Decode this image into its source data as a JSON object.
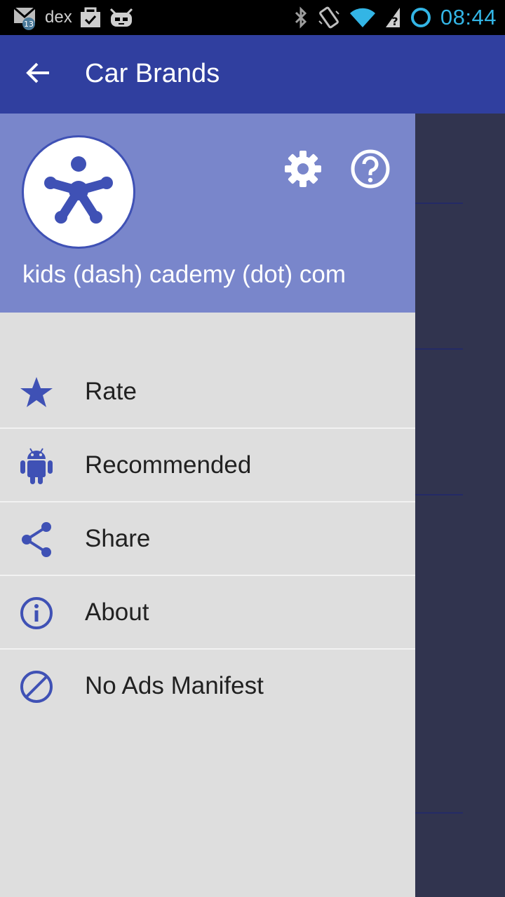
{
  "status_bar": {
    "carrier_text": "dex",
    "mail_badge": "13",
    "time": "08:44",
    "icons": [
      "mail-icon",
      "clipboard-check-icon",
      "android-robot-icon",
      "bluetooth-icon",
      "vibrate-icon",
      "wifi-icon",
      "signal-question-icon",
      "sync-ring-icon"
    ]
  },
  "app_bar": {
    "title": "Car Brands",
    "back_icon": "arrow-left-icon"
  },
  "drawer": {
    "header": {
      "site_text": "kids (dash) cademy (dot) com",
      "avatar_icon": "kids-academy-figure-icon",
      "settings_icon": "gear-icon",
      "help_icon": "help-circle-icon"
    },
    "menu": [
      {
        "label": "Rate",
        "icon": "star-icon"
      },
      {
        "label": "Recommended",
        "icon": "android-icon"
      },
      {
        "label": "Share",
        "icon": "share-icon"
      },
      {
        "label": "About",
        "icon": "info-icon"
      },
      {
        "label": "No Ads Manifest",
        "icon": "block-icon"
      }
    ]
  },
  "colors": {
    "primary": "#303f9f",
    "accent_icon": "#3f51b5",
    "header_bg": "#7986cb",
    "drawer_bg": "#dedede",
    "scrim": "#31344f",
    "clock": "#33b5e5"
  }
}
